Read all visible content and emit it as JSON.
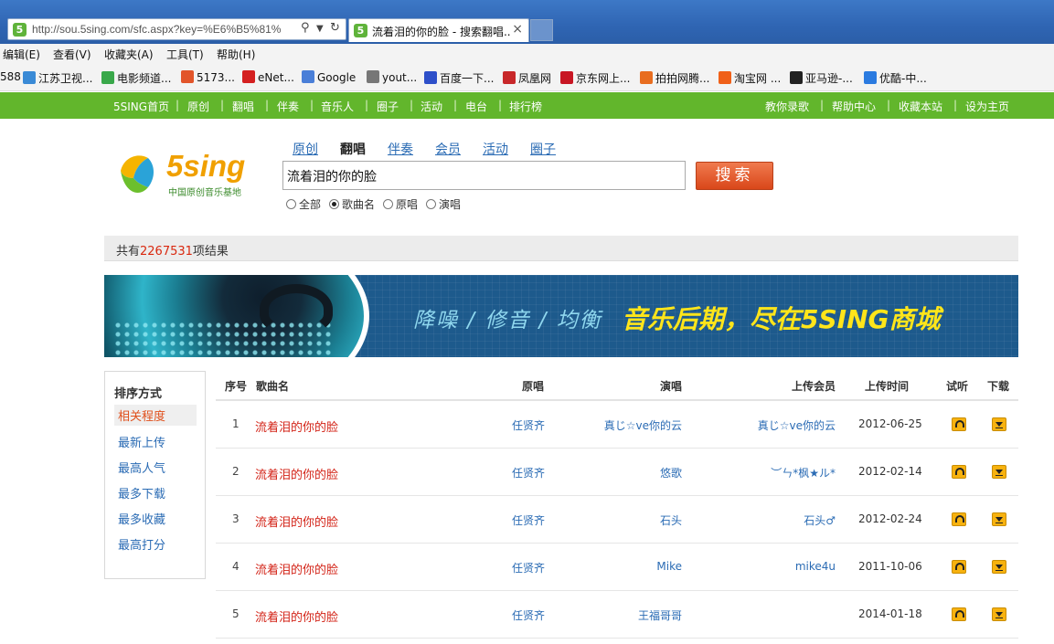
{
  "browser": {
    "url": "http://sou.5sing.com/sfc.aspx?key=%E6%B5%81%",
    "tab_title": "流着泪的你的脸 - 搜索翻唱...",
    "tab_close": "×",
    "menu": [
      "编辑(E)",
      "查看(V)",
      "收藏夹(A)",
      "工具(T)",
      "帮助(H)"
    ],
    "favorites": [
      {
        "label": "588",
        "color": ""
      },
      {
        "label": "江苏卫视...",
        "color": "#3a8ad6"
      },
      {
        "label": "电影频道...",
        "color": "#39a84a"
      },
      {
        "label": "5173...",
        "color": "#e2552a"
      },
      {
        "label": "eNet...",
        "color": "#d42020"
      },
      {
        "label": "Google",
        "color": "#4a7fd8"
      },
      {
        "label": "yout...",
        "color": "#777777"
      },
      {
        "label": "百度一下...",
        "color": "#2d4fc9"
      },
      {
        "label": "凤凰网",
        "color": "#c8282a"
      },
      {
        "label": "京东网上...",
        "color": "#c81623"
      },
      {
        "label": "拍拍网腾...",
        "color": "#e86d1f"
      },
      {
        "label": "淘宝网 ...",
        "color": "#f06018"
      },
      {
        "label": "亚马逊-...",
        "color": "#222222"
      },
      {
        "label": "优酷-中...",
        "color": "#2b7be0"
      }
    ]
  },
  "site_nav": {
    "left": [
      "5SING首页",
      "原创",
      "翻唱",
      "伴奏",
      "音乐人",
      "圈子",
      "活动",
      "电台",
      "排行榜"
    ],
    "right": [
      "教你录歌",
      "帮助中心",
      "收藏本站",
      "设为主页"
    ],
    "separator": "|"
  },
  "logo": {
    "brand": "5sing",
    "tagline": "中国原创音乐基地"
  },
  "search": {
    "tabs": [
      "原创",
      "翻唱",
      "伴奏",
      "会员",
      "活动",
      "圈子"
    ],
    "active_tab": "翻唱",
    "query": "流着泪的你的脸",
    "button": "搜索",
    "scopes": [
      "全部",
      "歌曲名",
      "原唱",
      "演唱"
    ],
    "selected_scope": "歌曲名"
  },
  "results": {
    "prefix": "共有",
    "count": "2267531",
    "suffix": "项结果"
  },
  "banner": {
    "left_text": "降噪 / 修音 / 均衡",
    "right_text": "音乐后期，尽在5SING商城"
  },
  "sort": {
    "title": "排序方式",
    "options": [
      "相关程度",
      "最新上传",
      "最高人气",
      "最多下载",
      "最多收藏",
      "最高打分"
    ],
    "active": "相关程度"
  },
  "table": {
    "headers": [
      "序号",
      "歌曲名",
      "原唱",
      "演唱",
      "上传会员",
      "上传时间",
      "试听",
      "下载"
    ],
    "rows": [
      {
        "idx": "1",
        "song": "流着泪的你的脸",
        "original": "任贤齐",
        "singer": "真じ☆ve你的云",
        "uploader": "真じ☆ve你的云",
        "date": "2012-06-25"
      },
      {
        "idx": "2",
        "song": "流着泪的你的脸",
        "original": "任贤齐",
        "singer": "悠歌",
        "uploader": "︶ㄣ*枫★ル*",
        "date": "2012-02-14"
      },
      {
        "idx": "3",
        "song": "流着泪的你的脸",
        "original": "任贤齐",
        "singer": "石头",
        "uploader": "石头♂",
        "date": "2012-02-24"
      },
      {
        "idx": "4",
        "song": "流着泪的你的脸",
        "original": "任贤齐",
        "singer": "Mike",
        "uploader": "mike4u",
        "date": "2011-10-06"
      },
      {
        "idx": "5",
        "song": "流着泪的你的脸",
        "original": "任贤齐",
        "singer": "王福哥哥",
        "uploader": "",
        "date": "2014-01-18"
      }
    ]
  },
  "colors": {
    "nav_green": "#62b62c",
    "link_blue": "#2a6bb4",
    "song_red": "#d32418",
    "button_orange": "#e0501c"
  }
}
